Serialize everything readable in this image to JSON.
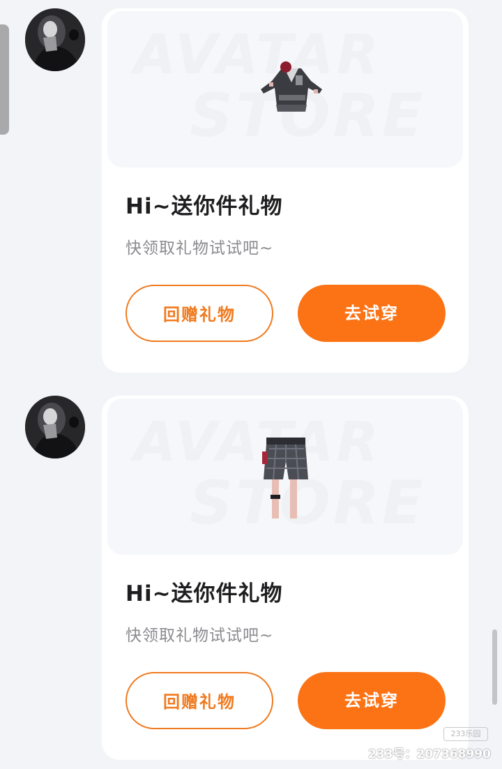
{
  "messages": [
    {
      "card": {
        "watermark_line1": "AVATAR",
        "watermark_line2": "STORE",
        "product": "jacket",
        "title": "Hi~送你件礼物",
        "subtitle": "快领取礼物试试吧~",
        "return_gift_label": "回赠礼物",
        "try_on_label": "去试穿"
      }
    },
    {
      "card": {
        "watermark_line1": "AVATAR",
        "watermark_line2": "STORE",
        "product": "shorts",
        "title": "Hi~送你件礼物",
        "subtitle": "快领取礼物试试吧~",
        "return_gift_label": "回赠礼物",
        "try_on_label": "去试穿"
      }
    }
  ],
  "footer": {
    "brand_logo": "233乐园",
    "account_id": "233号：207368990"
  },
  "colors": {
    "accent": "#fb7315",
    "background": "#f3f4f8"
  }
}
